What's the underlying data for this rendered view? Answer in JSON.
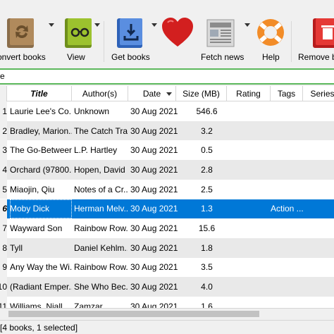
{
  "toolbar": {
    "convert_label": "onvert books",
    "view_label": "View",
    "get_label": "Get books",
    "fetch_label": "Fetch news",
    "help_label": "Help",
    "remove_label": "Remove bo"
  },
  "search": {
    "value": "e"
  },
  "table": {
    "headers": {
      "title": "Title",
      "authors": "Author(s)",
      "date": "Date",
      "size": "Size (MB)",
      "rating": "Rating",
      "tags": "Tags",
      "series": "Series"
    },
    "rows": [
      {
        "num": "1",
        "title": "Laurie Lee's Co...",
        "author": "Unknown",
        "date": "30 Aug 2021",
        "size": "546.6",
        "tags": ""
      },
      {
        "num": "2",
        "title": "Bradley, Marion...",
        "author": "The Catch Trap",
        "date": "30 Aug 2021",
        "size": "3.2",
        "tags": ""
      },
      {
        "num": "3",
        "title": "The Go-Between",
        "author": "L.P. Hartley",
        "date": "30 Aug 2021",
        "size": "0.5",
        "tags": ""
      },
      {
        "num": "4",
        "title": "Orchard (97800...",
        "author": "Hopen, David",
        "date": "30 Aug 2021",
        "size": "2.8",
        "tags": ""
      },
      {
        "num": "5",
        "title": "Miaojin, Qiu",
        "author": "Notes of a Cr...",
        "date": "30 Aug 2021",
        "size": "2.5",
        "tags": ""
      },
      {
        "num": "6",
        "title": "Moby Dick",
        "author": "Herman Melv...",
        "date": "30 Aug 2021",
        "size": "1.3",
        "tags": "Action ..."
      },
      {
        "num": "7",
        "title": "Wayward Son",
        "author": "Rainbow Row...",
        "date": "30 Aug 2021",
        "size": "15.6",
        "tags": ""
      },
      {
        "num": "8",
        "title": "Tyll",
        "author": "Daniel Kehlm...",
        "date": "30 Aug 2021",
        "size": "1.8",
        "tags": ""
      },
      {
        "num": "9",
        "title": "Any Way the Wi...",
        "author": "Rainbow Row...",
        "date": "30 Aug 2021",
        "size": "3.5",
        "tags": ""
      },
      {
        "num": "10",
        "title": "(Radiant Emper...",
        "author": "She Who Bec...",
        "date": "30 Aug 2021",
        "size": "4.0",
        "tags": ""
      },
      {
        "num": "11",
        "title": "Williams, Niall",
        "author": "Zamzar",
        "date": "30 Aug 2021",
        "size": "1.6",
        "tags": ""
      }
    ]
  },
  "status": {
    "text": "[4 books, 1 selected]"
  },
  "colors": {
    "selection": "#0078d7",
    "search_border": "#5cb85c",
    "heart": "#d21f1f"
  },
  "icons": [
    "convert-books-icon",
    "view-icon",
    "get-books-icon",
    "heart-icon",
    "fetch-news-icon",
    "help-icon",
    "remove-books-icon"
  ]
}
